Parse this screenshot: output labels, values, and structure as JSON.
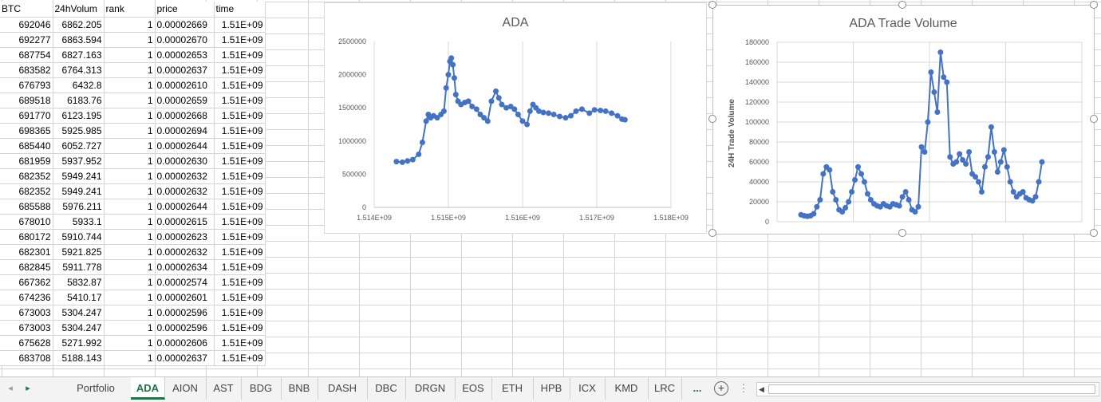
{
  "columns": [
    "BTC",
    "24hVolum",
    "rank",
    "price",
    "time"
  ],
  "rows": [
    [
      "692046",
      "6862.205",
      "1",
      "0.00002669",
      "1.51E+09"
    ],
    [
      "692277",
      "6863.594",
      "1",
      "0.00002670",
      "1.51E+09"
    ],
    [
      "687754",
      "6827.163",
      "1",
      "0.00002653",
      "1.51E+09"
    ],
    [
      "683582",
      "6764.313",
      "1",
      "0.00002637",
      "1.51E+09"
    ],
    [
      "676793",
      "6432.8",
      "1",
      "0.00002610",
      "1.51E+09"
    ],
    [
      "689518",
      "6183.76",
      "1",
      "0.00002659",
      "1.51E+09"
    ],
    [
      "691770",
      "6123.195",
      "1",
      "0.00002668",
      "1.51E+09"
    ],
    [
      "698365",
      "5925.985",
      "1",
      "0.00002694",
      "1.51E+09"
    ],
    [
      "685440",
      "6052.727",
      "1",
      "0.00002644",
      "1.51E+09"
    ],
    [
      "681959",
      "5937.952",
      "1",
      "0.00002630",
      "1.51E+09"
    ],
    [
      "682352",
      "5949.241",
      "1",
      "0.00002632",
      "1.51E+09"
    ],
    [
      "682352",
      "5949.241",
      "1",
      "0.00002632",
      "1.51E+09"
    ],
    [
      "685588",
      "5976.211",
      "1",
      "0.00002644",
      "1.51E+09"
    ],
    [
      "678010",
      "5933.1",
      "1",
      "0.00002615",
      "1.51E+09"
    ],
    [
      "680172",
      "5910.744",
      "1",
      "0.00002623",
      "1.51E+09"
    ],
    [
      "682301",
      "5921.825",
      "1",
      "0.00002632",
      "1.51E+09"
    ],
    [
      "682845",
      "5911.778",
      "1",
      "0.00002634",
      "1.51E+09"
    ],
    [
      "667362",
      "5832.87",
      "1",
      "0.00002574",
      "1.51E+09"
    ],
    [
      "674236",
      "5410.17",
      "1",
      "0.00002601",
      "1.51E+09"
    ],
    [
      "673003",
      "5304.247",
      "1",
      "0.00002596",
      "1.51E+09"
    ],
    [
      "673003",
      "5304.247",
      "1",
      "0.00002596",
      "1.51E+09"
    ],
    [
      "675628",
      "5271.992",
      "1",
      "0.00002606",
      "1.51E+09"
    ],
    [
      "683708",
      "5188.143",
      "1",
      "0.00002637",
      "1.51E+09"
    ]
  ],
  "chart_data": [
    {
      "type": "line",
      "title": "ADA",
      "xlabel": "",
      "ylabel": "",
      "xlim": [
        1514000000,
        1518000000
      ],
      "ylim": [
        0,
        2500000
      ],
      "xticks": [
        "1.514E+09",
        "1.515E+09",
        "1.516E+09",
        "1.517E+09",
        "1.518E+09"
      ],
      "yticks": [
        "0",
        "500000",
        "1000000",
        "1500000",
        "2000000",
        "2500000"
      ],
      "grid": "vertical",
      "color": "#4472C4",
      "x": [
        1514300000,
        1514380000,
        1514450000,
        1514520000,
        1514600000,
        1514650000,
        1514700000,
        1514730000,
        1514760000,
        1514800000,
        1514850000,
        1514900000,
        1514940000,
        1514970000,
        1515000000,
        1515020000,
        1515040000,
        1515060000,
        1515080000,
        1515100000,
        1515130000,
        1515170000,
        1515220000,
        1515270000,
        1515320000,
        1515380000,
        1515430000,
        1515480000,
        1515530000,
        1515580000,
        1515640000,
        1515680000,
        1515720000,
        1515780000,
        1515840000,
        1515890000,
        1515940000,
        1516000000,
        1516060000,
        1516100000,
        1516140000,
        1516180000,
        1516220000,
        1516280000,
        1516350000,
        1516420000,
        1516500000,
        1516580000,
        1516650000,
        1516720000,
        1516800000,
        1516900000,
        1516970000,
        1517050000,
        1517120000,
        1517200000,
        1517280000,
        1517340000,
        1517380000
      ],
      "y": [
        690000,
        680000,
        700000,
        720000,
        800000,
        980000,
        1300000,
        1400000,
        1350000,
        1380000,
        1350000,
        1400000,
        1450000,
        1800000,
        2000000,
        2200000,
        2250000,
        2150000,
        1950000,
        1700000,
        1600000,
        1550000,
        1580000,
        1600000,
        1520000,
        1480000,
        1400000,
        1350000,
        1300000,
        1600000,
        1750000,
        1650000,
        1550000,
        1500000,
        1520000,
        1480000,
        1400000,
        1300000,
        1250000,
        1450000,
        1550000,
        1500000,
        1450000,
        1430000,
        1420000,
        1400000,
        1370000,
        1350000,
        1380000,
        1450000,
        1480000,
        1420000,
        1470000,
        1460000,
        1450000,
        1420000,
        1380000,
        1330000,
        1320000
      ]
    },
    {
      "type": "line",
      "title": "ADA Trade Volume",
      "xlabel": "",
      "ylabel": "24H Trade Volume",
      "ylim": [
        0,
        180000
      ],
      "yticks": [
        "0",
        "20000",
        "40000",
        "60000",
        "80000",
        "100000",
        "120000",
        "140000",
        "160000",
        "180000"
      ],
      "grid": "both",
      "color": "#4472C4",
      "y": [
        7000,
        6000,
        5500,
        6000,
        8000,
        15000,
        22000,
        48000,
        55000,
        52000,
        30000,
        22000,
        12000,
        10000,
        14000,
        20000,
        30000,
        42000,
        55000,
        48000,
        40000,
        28000,
        22000,
        18000,
        16000,
        15000,
        18000,
        16000,
        15000,
        18000,
        17000,
        16000,
        25000,
        30000,
        22000,
        12000,
        10000,
        15000,
        75000,
        70000,
        100000,
        150000,
        130000,
        110000,
        170000,
        145000,
        140000,
        65000,
        58000,
        60000,
        68000,
        62000,
        58000,
        70000,
        48000,
        45000,
        40000,
        30000,
        55000,
        65000,
        95000,
        70000,
        50000,
        60000,
        72000,
        55000,
        40000,
        30000,
        25000,
        28000,
        30000,
        24000,
        22000,
        21000,
        25000,
        40000,
        60000
      ]
    }
  ],
  "tabs": [
    "Portfolio",
    "ADA",
    "AION",
    "AST",
    "BDG",
    "BNB",
    "DASH",
    "DBC",
    "DRGN",
    "EOS",
    "ETH",
    "HPB",
    "ICX",
    "KMD",
    "LRC"
  ],
  "active_tab": "ADA",
  "tab_more": "...",
  "add_sheet": "+",
  "sheet_options": "⋮",
  "scroll_left": "◀",
  "nav_prev": "◂",
  "nav_next": "▸"
}
